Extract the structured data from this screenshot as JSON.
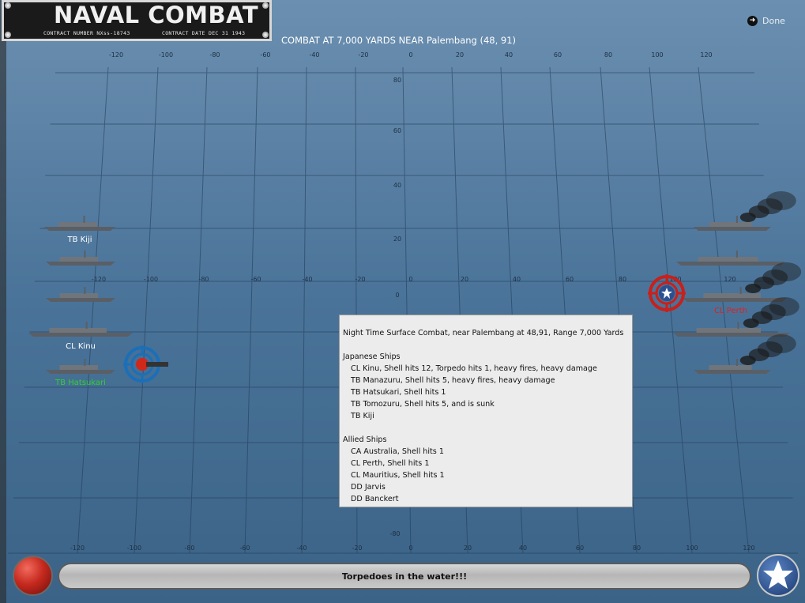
{
  "header": {
    "title": "NAVAL COMBAT",
    "contract_number": "CONTRACT NUMBER   NXss-18743",
    "contract_date": "CONTRACT DATE   DEC  31  1943",
    "combat_heading": "COMBAT AT 7,000 YARDS NEAR Palembang (48, 91)",
    "done_label": "Done"
  },
  "grid": {
    "top_x_labels": [
      "-120",
      "-100",
      "-80",
      "-60",
      "-40",
      "-20",
      "0",
      "20",
      "40",
      "60",
      "80",
      "100",
      "120"
    ],
    "top_y_labels": [
      "80",
      "60",
      "40",
      "20",
      "0"
    ],
    "mid_x_labels": [
      "-120",
      "-100",
      "-80",
      "-60",
      "-40",
      "-20",
      "0",
      "20",
      "40",
      "60",
      "80",
      "100",
      "120"
    ],
    "bottom_x_labels": [
      "-120",
      "-100",
      "-80",
      "-60",
      "-40",
      "-20",
      "0",
      "20",
      "40",
      "60",
      "80",
      "100",
      "120"
    ],
    "bottom_y_label": "-80"
  },
  "japanese_labels": {
    "kiji": "TB Kiji",
    "kinu": "CL Kinu",
    "hatsukari": "TB Hatsukari"
  },
  "allied_labels": {
    "perth": "CL Perth"
  },
  "report": {
    "title_line": "Night Time Surface Combat, near Palembang at 48,91, Range 7,000 Yards",
    "japanese_header": "Japanese Ships",
    "japanese_lines": [
      "CL Kinu, Shell hits 12, Torpedo hits 1,  heavy fires,  heavy damage",
      "TB Manazuru, Shell hits 5,  heavy fires,  heavy damage",
      "TB Hatsukari, Shell hits 1",
      "TB Tomozuru, Shell hits 5, and is sunk",
      "TB Kiji"
    ],
    "allied_header": "Allied Ships",
    "allied_lines": [
      "CA Australia, Shell hits 1",
      "CL Perth, Shell hits 1",
      "CL Mauritius, Shell hits 1",
      "DD Jarvis",
      "DD Banckert"
    ]
  },
  "status": {
    "message": "Torpedoes in the water!!!"
  },
  "colors": {
    "ocean": "#3f6a8f",
    "japanese_label": "#ffffff",
    "active_label": "#2fd12f",
    "allied_label": "#e02020"
  }
}
